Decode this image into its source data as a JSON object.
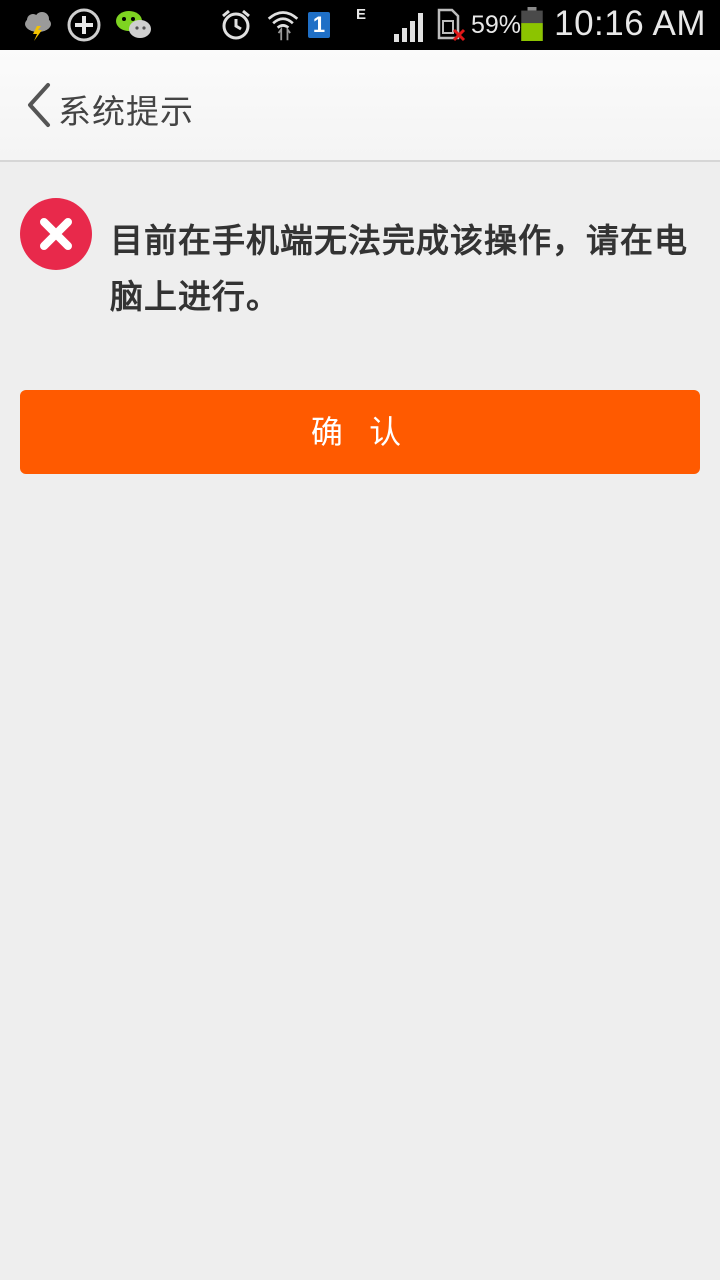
{
  "status_bar": {
    "battery_percent": "59%",
    "time": "10:16 AM",
    "network_type": "E",
    "sim_slot": "1",
    "battery_color": "#8cc400",
    "icons": [
      "weather-storm-icon",
      "add-circle-icon",
      "wechat-icon",
      "alarm-icon",
      "wifi-icon",
      "sim-1-icon",
      "network-e-icon",
      "signal-icon",
      "sim-no-card-icon",
      "battery-icon"
    ]
  },
  "header": {
    "back_icon": "chevron-left-icon",
    "title": "系统提示"
  },
  "dialog": {
    "icon": "error-x-icon",
    "icon_color": "#e8294b",
    "message": "目前在手机端无法完成该操作，请在电脑上进行。",
    "confirm_label": "确 认",
    "accent": "#ff5a00"
  }
}
